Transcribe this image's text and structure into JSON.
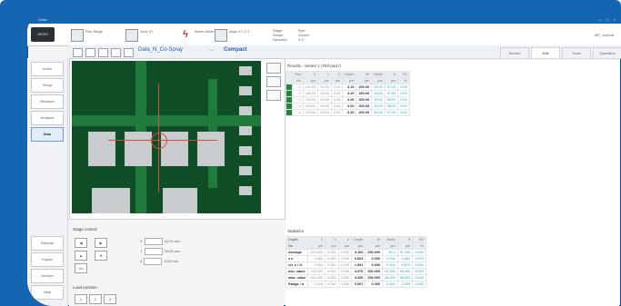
{
  "app": {
    "title": "Zeiss",
    "window_controls": "— □ ×"
  },
  "ribbon": {
    "items": [
      {
        "label": "Run Stage",
        "icon": "monitor-icon"
      },
      {
        "label": "Zero XY",
        "icon": "crosshair-icon"
      },
      {
        "label": "Alarm Mode",
        "icon": "lightning-icon"
      },
      {
        "label": "Align XY Z-T",
        "icon": "grid-icon"
      }
    ],
    "info_lines": [
      "Stage",
      "Scope",
      "Operator",
      "Run",
      "Center",
      "4.0"
    ],
    "user": "MP_Joshua"
  },
  "breadcrumb": {
    "text": "Data_N_Co-Spray",
    "sep": "...",
    "active": "Compact"
  },
  "tabs": [
    "Review",
    "Edit",
    "Tools",
    "Operation"
  ],
  "sidebar": {
    "items": [
      "Home",
      "Setup",
      "Measure",
      "Analysis",
      "Data",
      "Reports",
      "Export",
      "Archive",
      "Help"
    ]
  },
  "results": {
    "title": "Results - Series 1 | Ref pad 0",
    "headers": [
      "Pad",
      "X",
      "Y",
      "Z",
      "Depth",
      "W",
      "Width",
      "H",
      "FD"
    ],
    "units": [
      "No",
      "µm",
      "µm",
      "µm",
      "µm",
      "µm",
      "µm",
      "µm",
      "%"
    ],
    "rows": [
      [
        "1",
        "100.00",
        "40.00",
        "0.00",
        "3.10",
        "200.00",
        "25.00",
        "97.00",
        "3.00"
      ],
      [
        "2",
        "100.00",
        "45.00",
        "0.00",
        "3.20",
        "200.00",
        "25.00",
        "97.00",
        "3.00"
      ],
      [
        "3",
        "100.00",
        "50.00",
        "0.00",
        "3.30",
        "200.00",
        "25.00",
        "96.00",
        "3.00"
      ],
      [
        "4",
        "100.00",
        "55.00",
        "0.00",
        "3.00",
        "200.00",
        "25.00",
        "98.00",
        "3.00"
      ],
      [
        "5",
        "100.00",
        "60.00",
        "0.00",
        "3.20",
        "200.00",
        "25.00",
        "97.00",
        "3.00"
      ]
    ]
  },
  "statistics": {
    "title": "Statistics",
    "headers": [
      "Depth",
      "X",
      "Y",
      "Z",
      "Depth",
      "W",
      "Width",
      "H",
      "FD"
    ],
    "units": [
      "No",
      "µm",
      "µm",
      "µm",
      "µm",
      "µm",
      "µm",
      "µm",
      "%"
    ],
    "rows": [
      [
        "Average",
        "100.000",
        "0.000",
        "0.000",
        "3.163",
        "200.000",
        "25.0",
        "97.200",
        "3.000"
      ],
      [
        "s n",
        "0.000",
        "0.000",
        "0.000",
        "0.063",
        "0.000",
        "0.000",
        "0.652",
        "0.000"
      ],
      [
        "rel. s / %",
        "0.000",
        "0.000",
        "0.000",
        "1.991",
        "0.000",
        "0.000",
        "0.670",
        "0.000"
      ],
      [
        "min. value",
        "100.000",
        "0.000",
        "0.000",
        "3.070",
        "200.000",
        "25.000",
        "96.000",
        "3.000"
      ],
      [
        "max. value",
        "100.000",
        "0.000",
        "0.000",
        "3.260",
        "200.000",
        "25.000",
        "98.000",
        "3.000"
      ],
      [
        "Range / n",
        "0.000",
        "0.000",
        "0.000",
        "0.067",
        "0.000",
        "0.000",
        "2.000",
        "0.000"
      ]
    ]
  },
  "stage_control": {
    "title": "Stage control",
    "coords": [
      {
        "axis": "X",
        "value": "10.00",
        "unit": "mm"
      },
      {
        "axis": "Y",
        "value": "25.00",
        "unit": "mm"
      },
      {
        "axis": "Z",
        "value": "8.00",
        "unit": "mm"
      }
    ],
    "buttons": [
      "◀",
      "▶",
      "▲",
      "▼",
      "Go"
    ],
    "load_title": "Load position",
    "load_buttons": [
      "1",
      "2",
      "3"
    ]
  }
}
